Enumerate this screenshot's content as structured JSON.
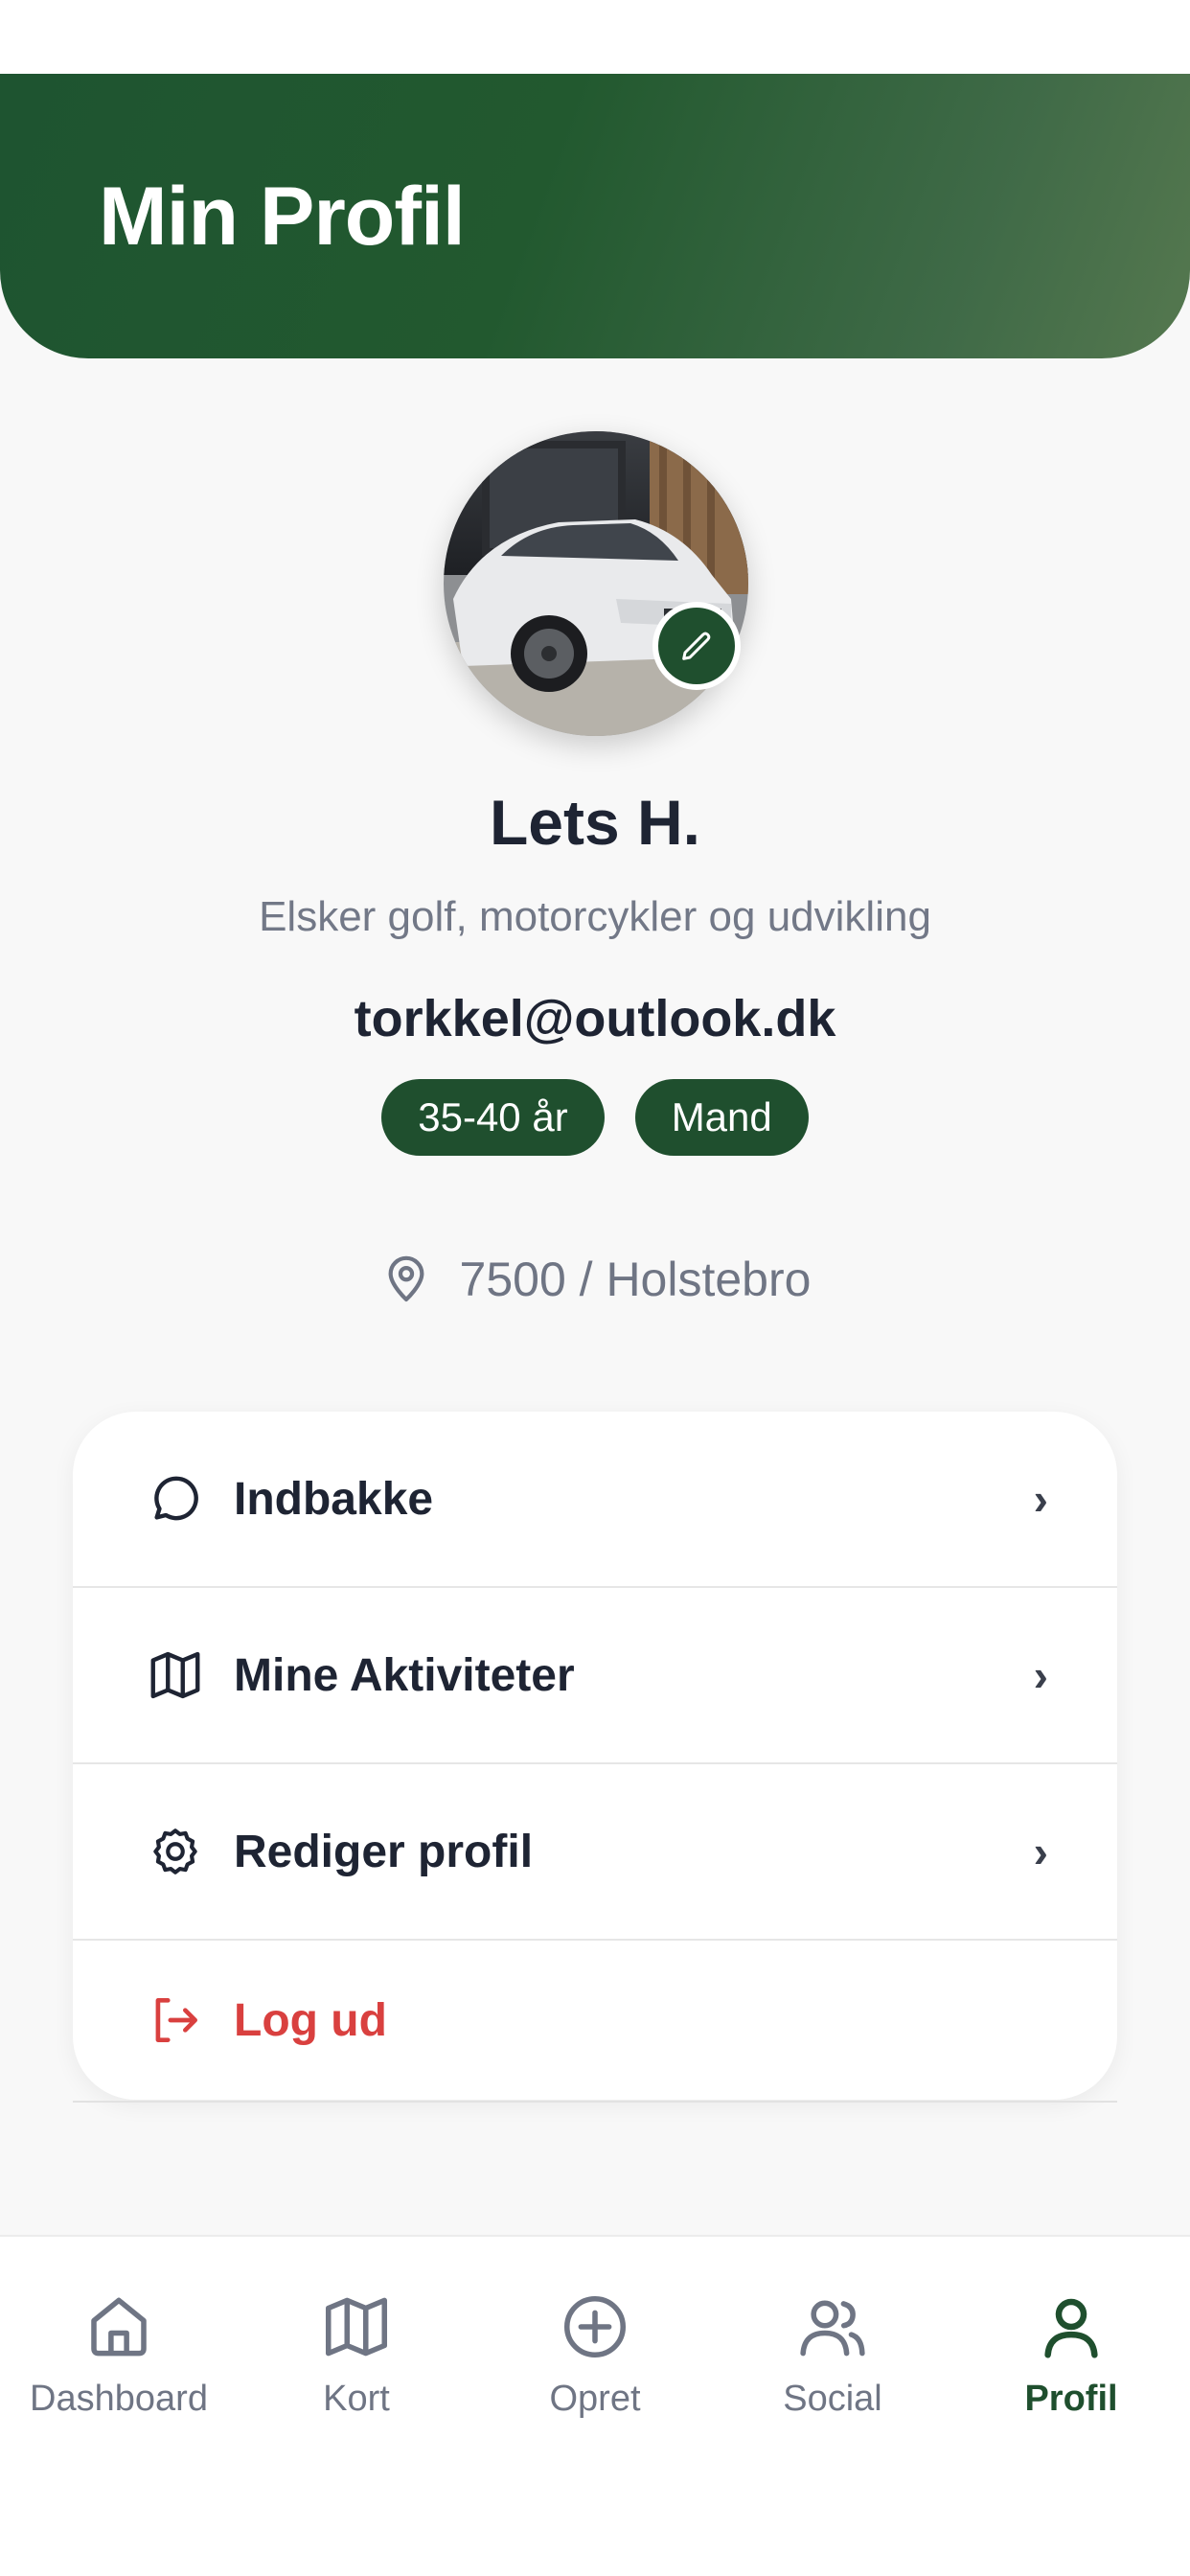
{
  "header": {
    "title": "Min Profil"
  },
  "profile": {
    "name": "Lets H.",
    "bio": "Elsker golf, motorcykler og udvikling",
    "email": "torkkel@outlook.dk",
    "badges": [
      "35-40 år",
      "Mand"
    ],
    "location": "7500 / Holstebro"
  },
  "menu": {
    "items": [
      {
        "label": "Indbakke",
        "icon": "chat-bubble-icon",
        "chevron": "›"
      },
      {
        "label": "Mine Aktiviteter",
        "icon": "map-icon",
        "chevron": "›"
      },
      {
        "label": "Rediger profil",
        "icon": "gear-icon",
        "chevron": "›"
      },
      {
        "label": "Log ud",
        "icon": "logout-icon"
      }
    ]
  },
  "nav": {
    "items": [
      {
        "label": "Dashboard",
        "icon": "home-icon",
        "active": false
      },
      {
        "label": "Kort",
        "icon": "map-icon",
        "active": false
      },
      {
        "label": "Opret",
        "icon": "plus-circle-icon",
        "active": false
      },
      {
        "label": "Social",
        "icon": "users-icon",
        "active": false
      },
      {
        "label": "Profil",
        "icon": "user-icon",
        "active": true
      }
    ]
  },
  "colors": {
    "brand_green": "#1f4f2e",
    "danger": "#d9403f",
    "text": "#1e2433",
    "muted": "#6f7584"
  }
}
